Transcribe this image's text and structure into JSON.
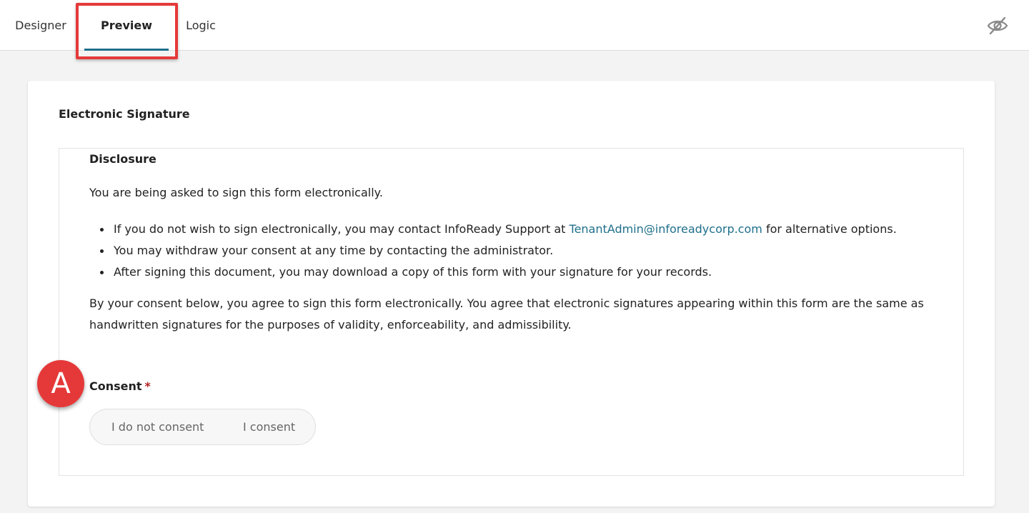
{
  "tabs": [
    {
      "label": "Designer"
    },
    {
      "label": "Preview"
    },
    {
      "label": "Logic"
    }
  ],
  "toolbar": {
    "visibility_icon": "eye-slash-icon"
  },
  "section": {
    "title": "Electronic Signature"
  },
  "disclosure": {
    "heading": "Disclosure",
    "intro": "You are being asked to sign this form electronically.",
    "bullet1_before": "If you do not wish to sign electronically, you may contact InfoReady Support at ",
    "bullet1_link": "TenantAdmin@inforeadycorp.com",
    "bullet1_after": " for alternative options.",
    "bullet2": "You may withdraw your consent at any time by contacting the administrator.",
    "bullet3": "After signing this document, you may download a copy of this form with your signature for your records.",
    "agreement": "By your consent below, you agree to sign this form electronically. You agree that electronic signatures appearing within this form are the same as handwritten signatures for the purposes of validity, enforceability, and admissibility."
  },
  "callout": {
    "letter": "A",
    "color": "#e53939"
  },
  "consent": {
    "label": "Consent",
    "required_mark": "*",
    "option_no": "I do not consent",
    "option_yes": "I consent"
  },
  "colors": {
    "accent": "#1f6f8b",
    "highlight": "#e53939"
  }
}
